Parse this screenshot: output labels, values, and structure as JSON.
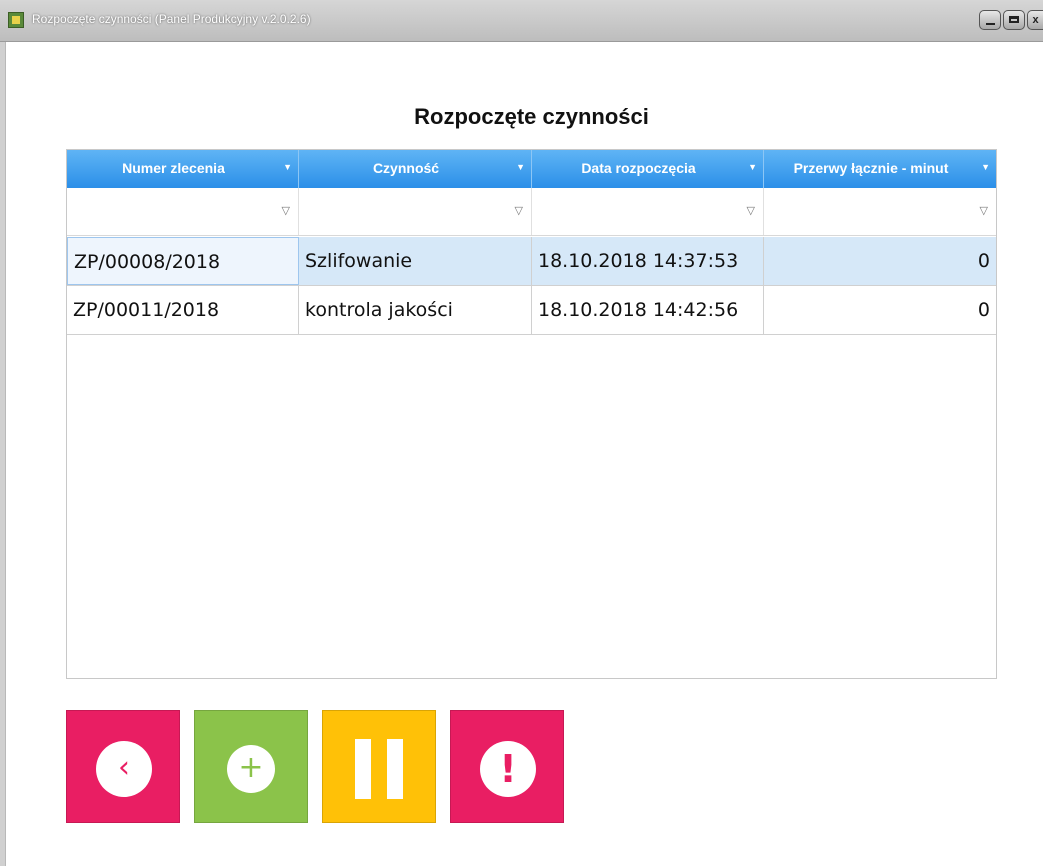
{
  "window": {
    "title": "Rozpoczęte czynności (Panel Produkcyjny v.2.0.2.6)",
    "controls": {
      "close": "x"
    }
  },
  "page_title": "Rozpoczęte czynności",
  "grid": {
    "columns": [
      "Numer zlecenia",
      "Czynność",
      "Data rozpoczęcia",
      "Przerwy łącznie - minut"
    ],
    "rows": [
      {
        "numer": "ZP/00008/2018",
        "czynnosc": "Szlifowanie",
        "data": "18.10.2018 14:37:53",
        "przerwy": "0",
        "selected": true
      },
      {
        "numer": "ZP/00011/2018",
        "czynnosc": "kontrola jakości",
        "data": "18.10.2018 14:42:56",
        "przerwy": "0",
        "selected": false
      }
    ],
    "filter_icon": "▼",
    "filter_row_icon": "▽"
  },
  "actions": {
    "back_glyph": "‹",
    "add_glyph": "+",
    "alert_glyph": "!"
  },
  "colors": {
    "header_blue": "#2b8fe8",
    "pink": "#e91e63",
    "green": "#8bc34a",
    "yellow": "#ffc107",
    "selected_row": "#d6e8f8"
  }
}
